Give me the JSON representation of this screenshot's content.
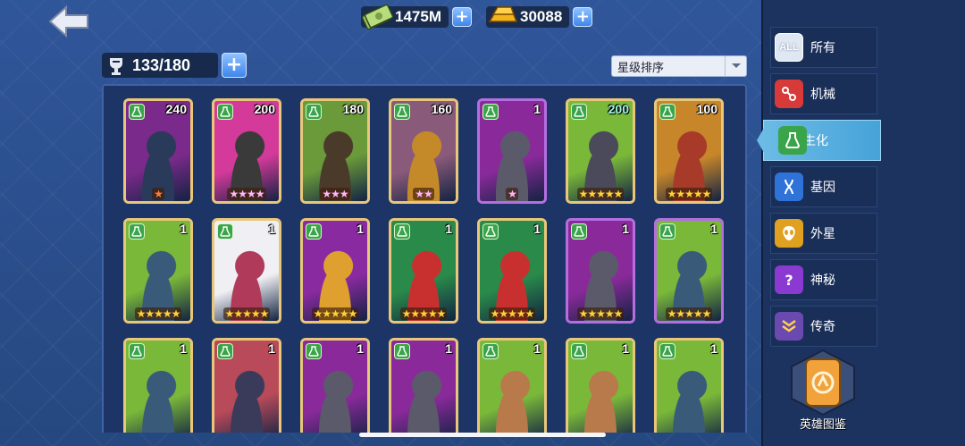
{
  "resources": {
    "cash": "1475M",
    "gold": "30088"
  },
  "capacity": "133/180",
  "sort": {
    "selected": "星级排序"
  },
  "categories": [
    {
      "label": "所有",
      "icon": "all-icon",
      "badge": "ALL",
      "color": "#dfe7f2"
    },
    {
      "label": "机械",
      "icon": "mechanical-icon",
      "color": "#d83a3a"
    },
    {
      "label": "生化",
      "icon": "flask-icon",
      "color": "#3aa44a",
      "active": true
    },
    {
      "label": "基因",
      "icon": "dna-icon",
      "color": "#2f72d8"
    },
    {
      "label": "外星",
      "icon": "alien-icon",
      "color": "#e0a020"
    },
    {
      "label": "神秘",
      "icon": "mystery-icon",
      "color": "#8a3ad0"
    },
    {
      "label": "传奇",
      "icon": "legend-icon",
      "color": "#6a4ab0"
    }
  ],
  "codex": {
    "label": "英雄图鉴",
    "icon": "hero-codex-icon"
  },
  "cards": [
    {
      "level": "240",
      "stars": 1,
      "star_style": "orange",
      "frame": "gold",
      "art": "#7a2a8a",
      "accent": "#2a3a5a"
    },
    {
      "level": "200",
      "stars": 4,
      "star_style": "pink",
      "frame": "gold",
      "art": "#d43a9a",
      "accent": "#3a3a3a"
    },
    {
      "level": "180",
      "stars": 3,
      "star_style": "pink",
      "frame": "gold",
      "art": "#6a9a3a",
      "accent": "#4a3a2a"
    },
    {
      "level": "160",
      "stars": 2,
      "star_style": "pink",
      "frame": "gold",
      "art": "#8a5a7a",
      "accent": "#c48a2a"
    },
    {
      "level": "1",
      "stars": 1,
      "star_style": "pink",
      "frame": "purple",
      "art": "#8a2a9a",
      "accent": "#5a5a6a"
    },
    {
      "level": "200",
      "level_style": "teal",
      "stars": 5,
      "star_style": "gold",
      "frame": "gold",
      "art": "#7ab83a",
      "accent": "#4a4a5a"
    },
    {
      "level": "100",
      "stars": 5,
      "star_style": "gold",
      "frame": "gold",
      "art": "#c8862a",
      "accent": "#a83a2a"
    },
    {
      "level": "1",
      "stars": 5,
      "star_style": "gold",
      "frame": "gold",
      "art": "#7ab83a",
      "accent": "#3a5a7a"
    },
    {
      "level": "1",
      "stars": 5,
      "star_style": "gold",
      "frame": "gold",
      "art": "#f0f0f4",
      "accent": "#b03a5a"
    },
    {
      "level": "1",
      "stars": 5,
      "star_style": "gold",
      "frame": "gold",
      "art": "#8a2aa0",
      "accent": "#e0a030"
    },
    {
      "level": "1",
      "stars": 5,
      "star_style": "gold",
      "frame": "gold",
      "art": "#2a8a4a",
      "accent": "#c83030"
    },
    {
      "level": "1",
      "stars": 5,
      "star_style": "gold",
      "frame": "gold",
      "art": "#2a8a4a",
      "accent": "#c83030"
    },
    {
      "level": "1",
      "stars": 5,
      "star_style": "gold",
      "frame": "purple",
      "art": "#8a2a9a",
      "accent": "#5a5a6a"
    },
    {
      "level": "1",
      "stars": 5,
      "star_style": "gold",
      "frame": "purple",
      "art": "#7ab83a",
      "accent": "#3a5a7a"
    },
    {
      "level": "1",
      "stars": 0,
      "frame": "gold",
      "art": "#7ab83a",
      "accent": "#3a5a7a"
    },
    {
      "level": "1",
      "stars": 0,
      "frame": "gold",
      "art": "#b84a5a",
      "accent": "#3a3a5a"
    },
    {
      "level": "1",
      "stars": 0,
      "frame": "gold",
      "art": "#8a2a9a",
      "accent": "#5a5a6a"
    },
    {
      "level": "1",
      "stars": 0,
      "frame": "gold",
      "art": "#8a2a9a",
      "accent": "#5a5a6a"
    },
    {
      "level": "1",
      "stars": 0,
      "frame": "gold",
      "art": "#7ab83a",
      "accent": "#b87a4a"
    },
    {
      "level": "1",
      "stars": 0,
      "frame": "gold",
      "art": "#7ab83a",
      "accent": "#b87a4a"
    },
    {
      "level": "1",
      "stars": 0,
      "frame": "gold",
      "art": "#7ab83a",
      "accent": "#3a5a7a"
    }
  ]
}
